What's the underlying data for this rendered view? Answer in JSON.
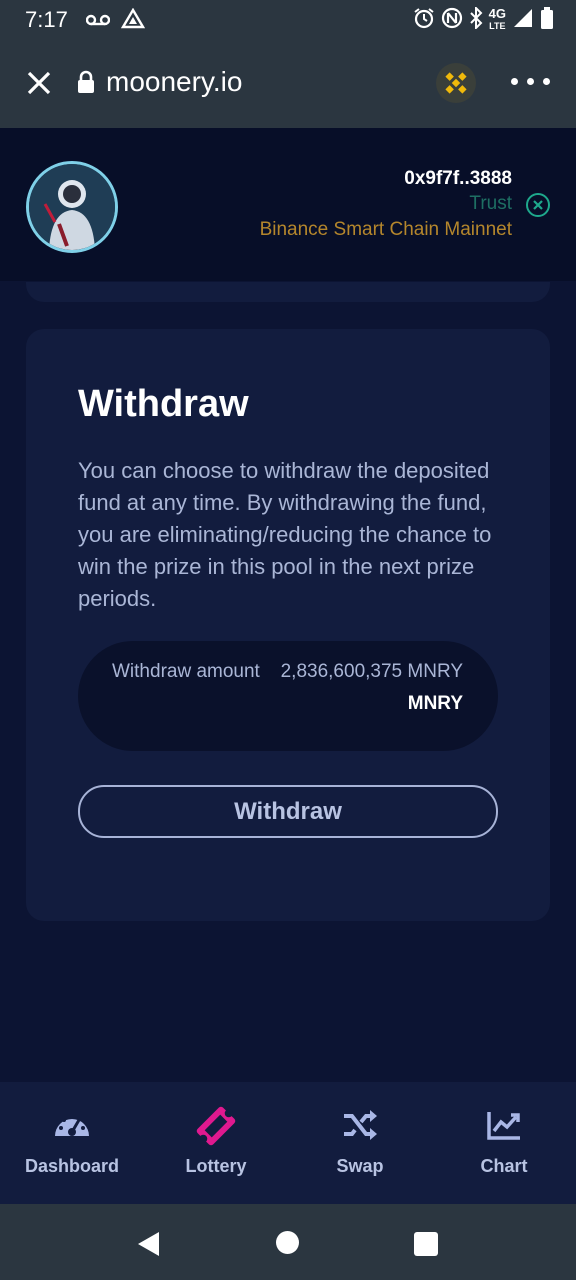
{
  "status_bar": {
    "time": "7:17",
    "network_type": "4G",
    "network_sub": "LTE"
  },
  "browser": {
    "url": "moonery.io"
  },
  "header": {
    "wallet_address": "0x9f7f..3888",
    "wallet_name": "Trust",
    "network": "Binance Smart Chain Mainnet"
  },
  "withdraw_card": {
    "title": "Withdraw",
    "description": "You can choose to withdraw the deposited fund at any time. By withdrawing the fund, you are eliminating/reducing the chance to win the prize in this pool in the next prize periods.",
    "amount_label": "Withdraw amount",
    "amount_value": "2,836,600,375 MNRY",
    "amount_unit": "MNRY",
    "button_label": "Withdraw"
  },
  "bottom_nav": {
    "items": [
      {
        "label": "Dashboard",
        "icon": "gauge-icon"
      },
      {
        "label": "Lottery",
        "icon": "ticket-icon"
      },
      {
        "label": "Swap",
        "icon": "shuffle-icon"
      },
      {
        "label": "Chart",
        "icon": "chart-line-icon"
      }
    ],
    "active": "Lottery"
  },
  "colors": {
    "background": "#0c1433",
    "card": "#121c3e",
    "accent_pink": "#e0198f",
    "wallet_green": "#1e6f63",
    "network_gold": "#b4862c"
  }
}
